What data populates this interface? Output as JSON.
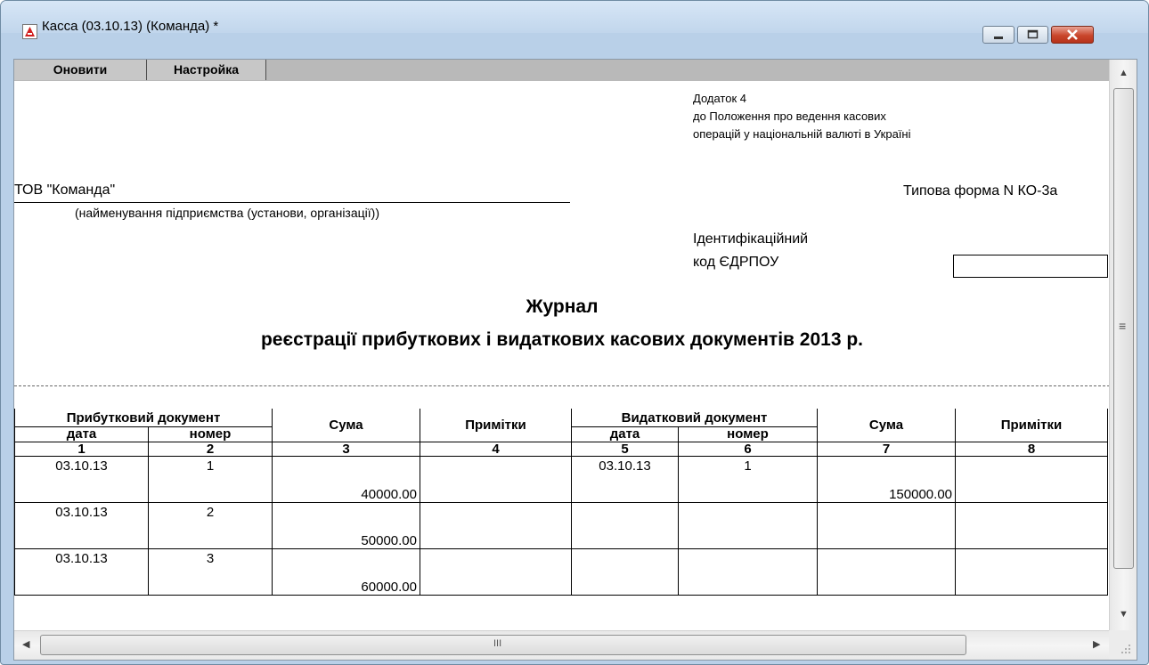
{
  "window": {
    "title": "Касса (03.10.13) (Команда)  *"
  },
  "toolbar": {
    "refresh_label": "Оновити",
    "settings_label": "Настройка"
  },
  "header": {
    "appendix_lines": [
      "Додаток 4",
      "до Положення про ведення касових",
      "операцій у національній валюті в Україні"
    ],
    "org_name": "ТОВ \"Команда\"",
    "org_caption": "(найменування підприємства (установи, організації))",
    "form_type": "Типова форма N КО-3а",
    "id_label_1": "Ідентифікаційний",
    "id_label_2": "код ЄДРПОУ",
    "edrpou_value": ""
  },
  "document": {
    "title": "Журнал",
    "subtitle": "реєстрації прибуткових і видаткових касових документів 2013 р."
  },
  "table": {
    "group_income": "Прибутковий документ",
    "group_expense": "Видатковий документ",
    "col_date": "дата",
    "col_number": "номер",
    "col_sum": "Сума",
    "col_notes": "Примітки",
    "col_numbers": [
      "1",
      "2",
      "3",
      "4",
      "5",
      "6",
      "7",
      "8"
    ],
    "rows": [
      {
        "in_date": "03.10.13",
        "in_num": "1",
        "in_sum": "40000.00",
        "in_note": "",
        "out_date": "03.10.13",
        "out_num": "1",
        "out_sum": "150000.00",
        "out_note": ""
      },
      {
        "in_date": "03.10.13",
        "in_num": "2",
        "in_sum": "50000.00",
        "in_note": "",
        "out_date": "",
        "out_num": "",
        "out_sum": "",
        "out_note": ""
      },
      {
        "in_date": "03.10.13",
        "in_num": "3",
        "in_sum": "60000.00",
        "in_note": "",
        "out_date": "",
        "out_num": "",
        "out_sum": "",
        "out_note": ""
      }
    ]
  },
  "scrollbar": {
    "hthumb_grip": "III",
    "vthumb_grip": "≡"
  }
}
